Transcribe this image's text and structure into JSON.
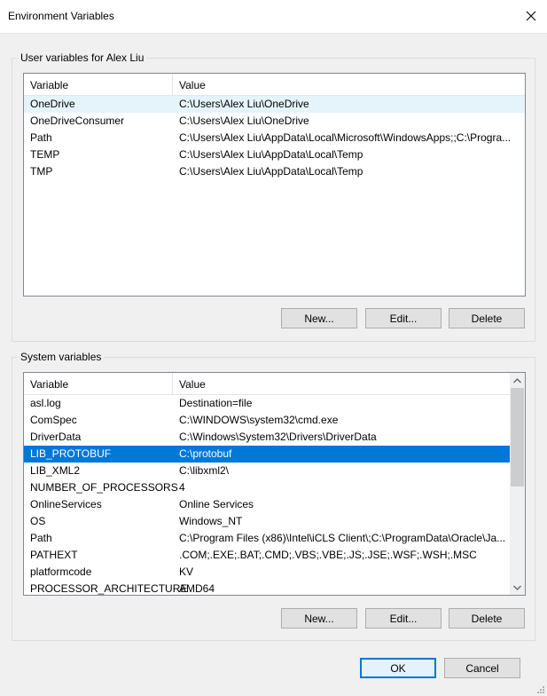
{
  "window": {
    "title": "Environment Variables"
  },
  "user_section": {
    "label": "User variables for Alex Liu",
    "headers": [
      "Variable",
      "Value"
    ],
    "rows": [
      [
        "OneDrive",
        "C:\\Users\\Alex Liu\\OneDrive"
      ],
      [
        "OneDriveConsumer",
        "C:\\Users\\Alex Liu\\OneDrive"
      ],
      [
        "Path",
        "C:\\Users\\Alex Liu\\AppData\\Local\\Microsoft\\WindowsApps;;C:\\Progra..."
      ],
      [
        "TEMP",
        "C:\\Users\\Alex Liu\\AppData\\Local\\Temp"
      ],
      [
        "TMP",
        "C:\\Users\\Alex Liu\\AppData\\Local\\Temp"
      ]
    ],
    "buttons": {
      "new": "New...",
      "edit": "Edit...",
      "delete": "Delete"
    }
  },
  "system_section": {
    "label": "System variables",
    "headers": [
      "Variable",
      "Value"
    ],
    "rows": [
      [
        "asl.log",
        "Destination=file"
      ],
      [
        "ComSpec",
        "C:\\WINDOWS\\system32\\cmd.exe"
      ],
      [
        "DriverData",
        "C:\\Windows\\System32\\Drivers\\DriverData"
      ],
      [
        "LIB_PROTOBUF",
        "C:\\protobuf"
      ],
      [
        "LIB_XML2",
        "C:\\libxml2\\"
      ],
      [
        "NUMBER_OF_PROCESSORS",
        "4"
      ],
      [
        "OnlineServices",
        "Online Services"
      ],
      [
        "OS",
        "Windows_NT"
      ],
      [
        "Path",
        "C:\\Program Files (x86)\\Intel\\iCLS Client\\;C:\\ProgramData\\Oracle\\Ja..."
      ],
      [
        "PATHEXT",
        ".COM;.EXE;.BAT;.CMD;.VBS;.VBE;.JS;.JSE;.WSF;.WSH;.MSC"
      ],
      [
        "platformcode",
        "KV"
      ],
      [
        "PROCESSOR_ARCHITECTURE",
        "AMD64"
      ]
    ],
    "buttons": {
      "new": "New...",
      "edit": "Edit...",
      "delete": "Delete"
    }
  },
  "footer": {
    "ok": "OK",
    "cancel": "Cancel"
  },
  "colors": {
    "selection": "#0078d7",
    "hover": "#e5f3fb"
  }
}
